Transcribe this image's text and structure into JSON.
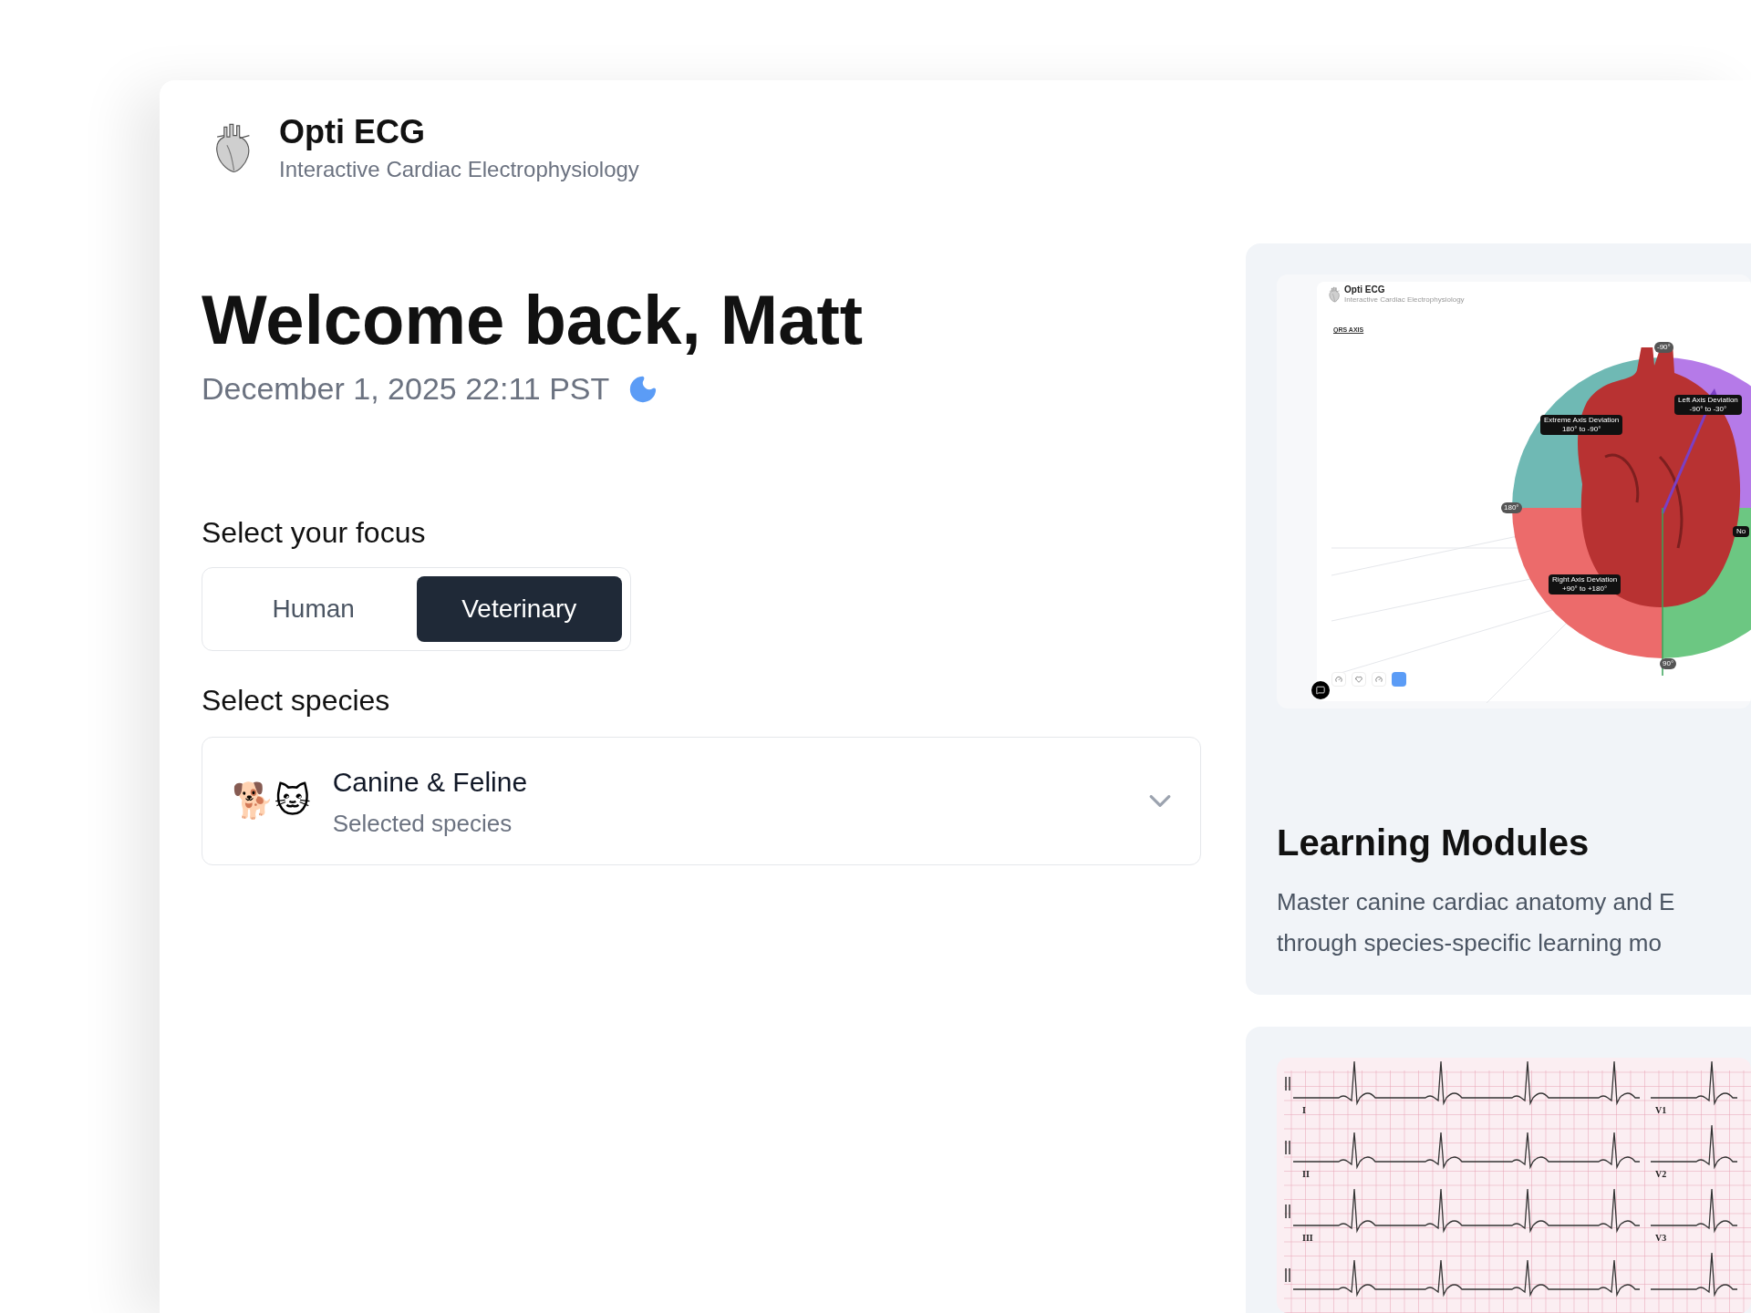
{
  "app": {
    "title": "Opti ECG",
    "subtitle": "Interactive Cardiac Electrophysiology"
  },
  "greeting": {
    "title": "Welcome back, Matt",
    "datetime": "December 1, 2025 22:11 PST"
  },
  "focus": {
    "label": "Select your focus",
    "options": [
      {
        "label": "Human",
        "selected": false
      },
      {
        "label": "Veterinary",
        "selected": true
      }
    ]
  },
  "species": {
    "label": "Select species",
    "icon": "🐕🐱",
    "value": "Canine & Feline",
    "hint": "Selected species"
  },
  "modules": [
    {
      "kind": "axis",
      "preview": {
        "app_title": "Opti ECG",
        "app_subtitle": "Interactive Cardiac Electrophysiology",
        "section": "QRS AXIS",
        "zones": [
          {
            "name": "Extreme Axis Deviation",
            "range": "180° to -90°"
          },
          {
            "name": "Left Axis Deviation",
            "range": "-90° to -30°"
          },
          {
            "name": "Right Axis Deviation",
            "range": "+90° to +180°"
          },
          {
            "name": "No"
          }
        ],
        "degree_marks": [
          "-90°",
          "180°",
          "90°"
        ]
      },
      "title": "Learning Modules",
      "description_lines": [
        "Master canine cardiac anatomy and E",
        "through species-specific learning mo"
      ]
    },
    {
      "kind": "ecg",
      "preview": {
        "leads": [
          "I",
          "II",
          "III",
          "V1",
          "V2",
          "V3"
        ]
      }
    }
  ]
}
